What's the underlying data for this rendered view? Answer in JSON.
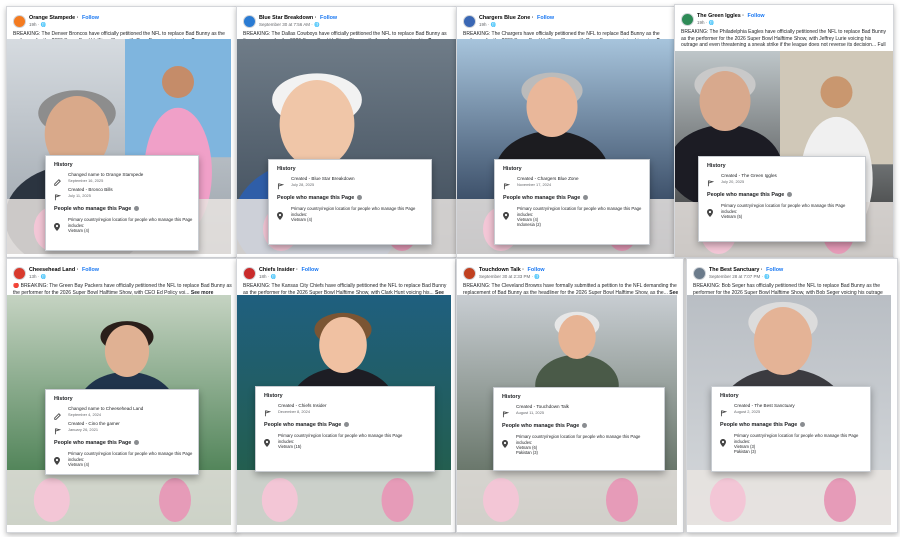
{
  "common": {
    "follow": "Follow",
    "see_more": "See more",
    "history_title": "History",
    "people_title": "People who manage this Page",
    "location_label": "Primary country/region location for people who manage this Page",
    "includes": "includes:"
  },
  "colors": {
    "link": "#1877f2",
    "text": "#1c1e21",
    "muted": "#65676b"
  },
  "cards": [
    {
      "page_name": "Orange Stampede",
      "meta": "19h · 🌐",
      "post_text": "BREAKING: The Denver Broncos have officially petitioned the NFL to replace Bad Bunny as the performer for the 2026 Super Bowl Halftime Show, with Greg Penner voicing h...",
      "history": [
        {
          "icon": "pencil-icon",
          "text": "Changed name to Orange Stampede",
          "date": "September 16, 2025"
        },
        {
          "icon": "flag-icon",
          "text": "Created - Bronco Bills",
          "date": "July 11, 2025"
        }
      ],
      "locations": [
        "Vietnam (4)"
      ]
    },
    {
      "page_name": "Blue Star Breakdown",
      "meta": "September 30 at 7:56 AM · 🌐",
      "post_text": "BREAKING: The Dallas Cowboys have officially petitioned the NFL to replace Bad Bunny as the performer for the 2026 Super Bowl Halftime Show, with Jerry Jones voicing hi...",
      "history": [
        {
          "icon": "flag-icon",
          "text": "Created - Blue Star Breakdown",
          "date": "July 28, 2025"
        }
      ],
      "locations": [
        "Vietnam (4)"
      ]
    },
    {
      "page_name": "Chargers Blue Zone",
      "meta": "19h · 🌐",
      "post_text": "BREAKING: The Chargers have officially petitioned the NFL to replace Bad Bunny as the performer for the 2026 Super Bowl Halftime Show, with Dean Spanos voicing his outr...",
      "history": [
        {
          "icon": "flag-icon",
          "text": "Created - Chargers Blue Zone",
          "date": "November 17, 2024"
        }
      ],
      "locations": [
        "Vietnam (4)",
        "Indonesia (2)"
      ]
    },
    {
      "page_name": "The Green Iggles",
      "meta": "19h · 🌐",
      "post_text": "BREAKING: The Philadelphia Eagles have officially petitioned the NFL to replace Bad Bunny as the performer for the 2026 Super Bowl Halftime Show, with Jeffrey Lurie voicing his outrage and even threatening a sneak strike if the league does not reverse its decision... Full details: https://flipperclaw.thoreon.com/breaking-the...",
      "history": [
        {
          "icon": "flag-icon",
          "text": "Created - The Green Iggles",
          "date": "July 20, 2025"
        }
      ],
      "locations": [
        "Vietnam (5)"
      ]
    },
    {
      "page_name": "Cheesehead Land",
      "meta": "13h · 🌐",
      "post_text": "🔴 BREAKING: The Green Bay Packers have officially petitioned the NFL to replace Bad Bunny as the performer for the 2026 Super Bowl Halftime Show, with CEO Ed Policy voi...",
      "history": [
        {
          "icon": "pencil-icon",
          "text": "Changed name to Cheesehead Land",
          "date": "September 4, 2024"
        },
        {
          "icon": "flag-icon",
          "text": "Created - Cino the gamer",
          "date": "January 26, 2021"
        }
      ],
      "locations": [
        "Vietnam (4)"
      ]
    },
    {
      "page_name": "Chiefs Insider",
      "meta": "18h · 🌐",
      "post_text": "BREAKING: The Kansas City Chiefs have officially petitioned the NFL to replace Bad Bunny as the performer for the 2026 Super Bowl Halftime Show, with Clark Hunt voicing his...",
      "history": [
        {
          "icon": "flag-icon",
          "text": "Created - Chiefs Insider",
          "date": "December 8, 2024"
        }
      ],
      "locations": [
        "Vietnam (15)"
      ]
    },
    {
      "page_name": "Touchdown Talk",
      "meta": "September 30 at 2:33 PM · 🌐",
      "post_text": "BREAKING: The Cleveland Browns have formally submitted a petition to the NFL demanding the replacement of Bad Bunny as the headliner for the 2026 Super Bowl Halftime Show, as the...",
      "history": [
        {
          "icon": "flag-icon",
          "text": "Created - Touchdown Talk",
          "date": "August 11, 2025"
        }
      ],
      "locations": [
        "Vietnam (6)",
        "Pakistan (3)"
      ]
    },
    {
      "page_name": "The Best Sanctuary",
      "meta": "September 28 at 7:07 PM · 🌐",
      "post_text": "BREAKING: Bob Seger has officially petitioned the NFL to replace Bad Bunny as the performer for the 2026 Super Bowl Halftime Show, with Bob Seger voicing his outrage an...",
      "history": [
        {
          "icon": "flag-icon",
          "text": "Created - The Best Sanctuary",
          "date": "August 2, 2025"
        }
      ],
      "locations": [
        "Vietnam (3)",
        "Pakistan (3)"
      ]
    }
  ]
}
